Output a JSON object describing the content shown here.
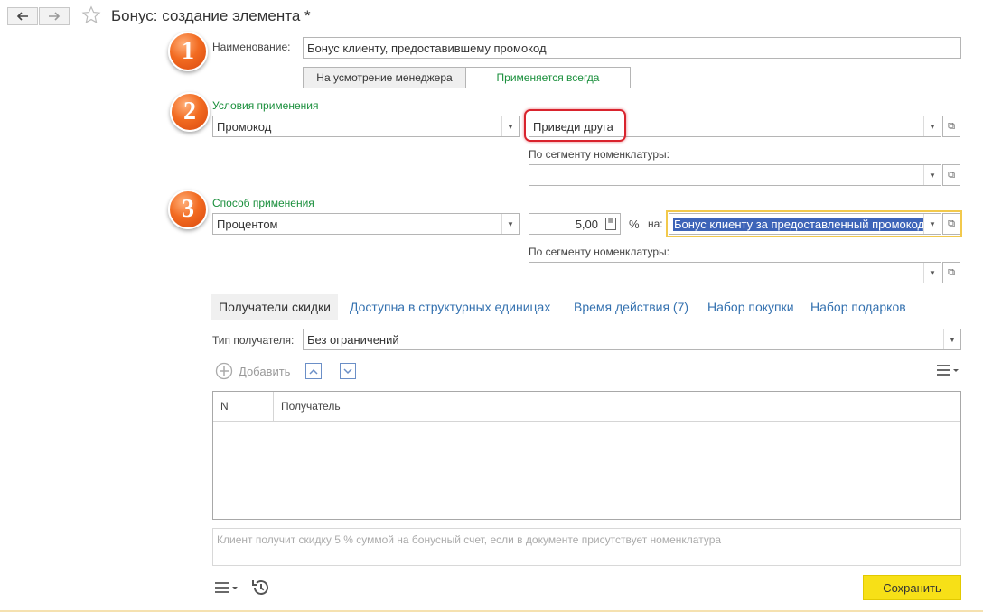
{
  "window": {
    "title": "Бонус: создание элемента *"
  },
  "badges": [
    "1",
    "2",
    "3"
  ],
  "name_field": {
    "label": "Наименование:",
    "value": "Бонус клиенту, предоставившему промокод"
  },
  "mode_toggle": {
    "option1": "На усмотрение менеджера",
    "option2": "Применяется всегда"
  },
  "conditions": {
    "heading": "Условия применения",
    "type_value": "Промокод",
    "promo_value": "Приведи друга",
    "segment_label": "По сегменту номенклатуры:",
    "segment_value": ""
  },
  "method": {
    "heading": "Способ применения",
    "type_value": "Процентом",
    "amount": "5,00",
    "percent_sign": "%",
    "on_label": "на:",
    "target_value": "Бонус клиенту за предоставленный промокод",
    "segment_label": "По сегменту номенклатуры:",
    "segment_value": ""
  },
  "tabs": [
    {
      "label": "Получатели скидки"
    },
    {
      "label": "Доступна в структурных единицах"
    },
    {
      "label": "Время действия (7)"
    },
    {
      "label": "Набор покупки"
    },
    {
      "label": "Набор подарков"
    }
  ],
  "recipient": {
    "label": "Тип получателя:",
    "value": "Без ограничений"
  },
  "toolbar": {
    "add_label": "Добавить"
  },
  "table": {
    "columns": [
      "N",
      "Получатель"
    ]
  },
  "info_text": "Клиент получит скидку 5 % суммой на бонусный счет, если в документе присутствует номенклатура",
  "footer": {
    "save_label": "Сохранить"
  }
}
